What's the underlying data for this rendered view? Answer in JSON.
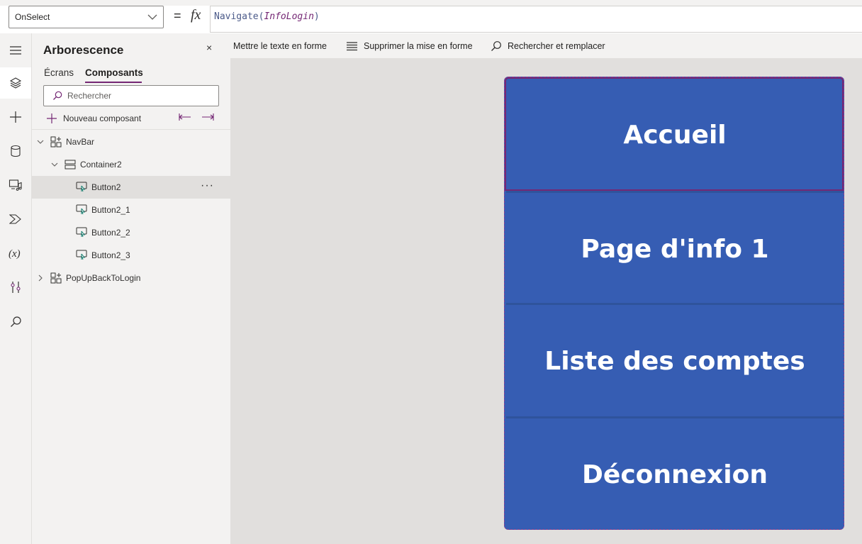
{
  "formula_bar": {
    "property": "OnSelect",
    "equals": "=",
    "fx": "fx",
    "formula_func": "Navigate(",
    "formula_arg": "InfoLogin",
    "formula_close": ")"
  },
  "format_toolbar": {
    "format_text": "Mettre le texte en forme",
    "remove_format": "Supprimer la mise en forme",
    "find_replace": "Rechercher et remplacer"
  },
  "tree_panel": {
    "title": "Arborescence",
    "tabs": [
      "Écrans",
      "Composants"
    ],
    "active_tab": "Composants",
    "search_placeholder": "Rechercher",
    "new_component": "Nouveau composant",
    "items": [
      {
        "label": "NavBar",
        "level": 0,
        "type": "component",
        "expanded": true
      },
      {
        "label": "Container2",
        "level": 1,
        "type": "container",
        "expanded": true
      },
      {
        "label": "Button2",
        "level": 2,
        "type": "button",
        "selected": true
      },
      {
        "label": "Button2_1",
        "level": 2,
        "type": "button"
      },
      {
        "label": "Button2_2",
        "level": 2,
        "type": "button"
      },
      {
        "label": "Button2_3",
        "level": 2,
        "type": "button"
      },
      {
        "label": "PopUpBackToLogin",
        "level": 0,
        "type": "component",
        "expanded": false
      }
    ],
    "more": "···"
  },
  "rail_icons": [
    "menu-icon",
    "tree-view-icon",
    "insert-icon",
    "data-icon",
    "media-icon",
    "power-automate-icon",
    "variables-icon",
    "tools-icon",
    "search-icon"
  ],
  "canvas": {
    "buttons": [
      "Accueil",
      "Page d'info 1",
      "Liste des comptes",
      "Déconnexion"
    ]
  },
  "colors": {
    "accent": "#742774",
    "button_fill": "#365db3",
    "canvas_bg": "#e1dfdd"
  }
}
